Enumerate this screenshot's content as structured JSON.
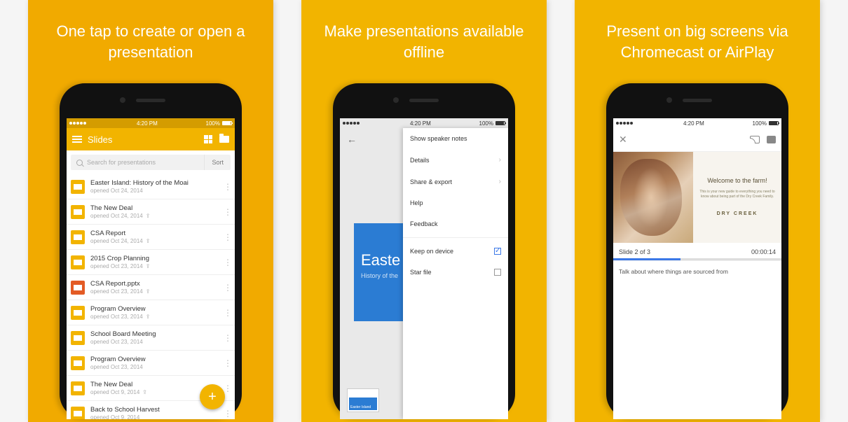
{
  "panels": [
    {
      "caption": "One tap to create or open a presentation"
    },
    {
      "caption": "Make presentations available offline"
    },
    {
      "caption": "Present on big screens via Chromecast or AirPlay"
    }
  ],
  "statusbar": {
    "time": "4:20 PM",
    "battery": "100%"
  },
  "screen1": {
    "app_title": "Slides",
    "search_placeholder": "Search for presentations",
    "sort_label": "Sort",
    "files": [
      {
        "title": "Easter Island: History of the Moai",
        "sub": "opened Oct 24, 2014",
        "shared": false,
        "type": "slides"
      },
      {
        "title": "The New Deal",
        "sub": "opened Oct 24, 2014",
        "shared": true,
        "type": "slides"
      },
      {
        "title": "CSA Report",
        "sub": "opened Oct 24, 2014",
        "shared": true,
        "type": "slides"
      },
      {
        "title": "2015 Crop Planning",
        "sub": "opened Oct 23, 2014",
        "shared": true,
        "type": "slides"
      },
      {
        "title": "CSA Report.pptx",
        "sub": "opened Oct 23, 2014",
        "shared": true,
        "type": "pptx"
      },
      {
        "title": "Program Overview",
        "sub": "opened Oct 23, 2014",
        "shared": true,
        "type": "slides"
      },
      {
        "title": "School Board Meeting",
        "sub": "opened Oct 23, 2014",
        "shared": false,
        "type": "slides"
      },
      {
        "title": "Program Overview",
        "sub": "opened Oct 23, 2014",
        "shared": false,
        "type": "slides"
      },
      {
        "title": "The New Deal",
        "sub": "opened Oct 9, 2014",
        "shared": true,
        "type": "slides"
      },
      {
        "title": "Back to School Harvest",
        "sub": "opened Oct 9, 2014",
        "shared": false,
        "type": "slides"
      }
    ]
  },
  "screen2": {
    "slide_title": "Easte",
    "slide_sub": "History of the",
    "thumb_label": "Easter Island",
    "menu": [
      {
        "label": "Show speaker notes",
        "type": "plain"
      },
      {
        "label": "Details",
        "type": "chev"
      },
      {
        "label": "Share & export",
        "type": "chev"
      },
      {
        "label": "Help",
        "type": "plain"
      },
      {
        "label": "Feedback",
        "type": "plain"
      }
    ],
    "menu2": [
      {
        "label": "Keep on device",
        "checked": true
      },
      {
        "label": "Star file",
        "checked": false
      }
    ]
  },
  "screen3": {
    "welcome": "Welcome to the farm!",
    "desc": "This is your new guide to everything you need to know about being part of the Dry Creek Family.",
    "brand": "DRY CREEK",
    "brand_loc": "",
    "slide_counter": "Slide 2 of 3",
    "timer": "00:00:14",
    "notes": "Talk about where things are sourced from"
  }
}
